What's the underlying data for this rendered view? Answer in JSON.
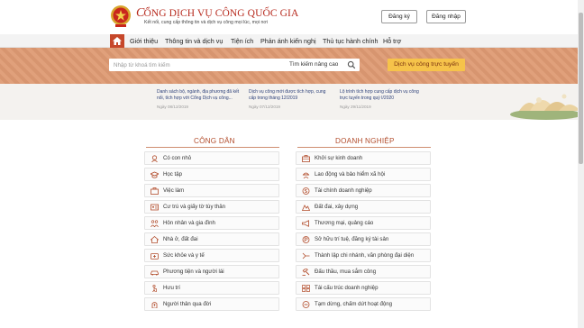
{
  "header": {
    "title_first_letter": "C",
    "title_rest": "ỔNG DỊCH VỤ CÔNG QUỐC GIA",
    "subtitle": "Kết nối, cung cấp thông tin và dịch vụ công mọi lúc, mọi nơi",
    "register_label": "Đăng ký",
    "login_label": "Đăng nhập"
  },
  "nav": {
    "items": [
      "Giới thiệu",
      "Thông tin và dịch vụ",
      "Tiện ích",
      "Phản ánh kiến nghị",
      "Thủ tục hành chính",
      "Hỗ trợ"
    ]
  },
  "search": {
    "placeholder": "Nhập từ khoá tìm kiếm",
    "advanced_label": "Tìm kiếm nâng cao",
    "public_service_label": "Dịch vụ công trực tuyến"
  },
  "news": [
    {
      "title": "Danh sách bộ, ngành, địa phương đã kết nối, tích hợp với Cổng Dịch vụ công...",
      "date": "Ngày 08/12/2019"
    },
    {
      "title": "Dịch vụ công mới được tích hợp, cung cấp trong tháng 12/2019",
      "date": "Ngày 07/12/2019"
    },
    {
      "title": "Lộ trình tích hợp cung cấp dịch vụ công trực tuyến trong quý I/2020",
      "date": "Ngày 29/11/2019"
    }
  ],
  "citizen": {
    "title": "CÔNG DÂN",
    "items": [
      {
        "label": "Có con nhỏ",
        "icon": "baby-icon"
      },
      {
        "label": "Học tập",
        "icon": "graduation-cap-icon"
      },
      {
        "label": "Việc làm",
        "icon": "briefcase-icon"
      },
      {
        "label": "Cư trú và giấy tờ tùy thân",
        "icon": "id-card-icon"
      },
      {
        "label": "Hôn nhân và gia đình",
        "icon": "family-icon"
      },
      {
        "label": "Nhà ở, đất đai",
        "icon": "house-icon"
      },
      {
        "label": "Sức khỏe và y tế",
        "icon": "medical-icon"
      },
      {
        "label": "Phương tiện và người lái",
        "icon": "car-icon"
      },
      {
        "label": "Hưu trí",
        "icon": "retirement-icon"
      },
      {
        "label": "Người thân qua đời",
        "icon": "memorial-icon"
      }
    ]
  },
  "business": {
    "title": "DOANH NGHIỆP",
    "items": [
      {
        "label": "Khởi sự kinh doanh",
        "icon": "startup-icon"
      },
      {
        "label": "Lao động và bảo hiểm xã hội",
        "icon": "worker-icon"
      },
      {
        "label": "Tài chính doanh nghiệp",
        "icon": "finance-icon"
      },
      {
        "label": "Đất đai, xây dựng",
        "icon": "construction-icon"
      },
      {
        "label": "Thương mại, quảng cáo",
        "icon": "megaphone-icon"
      },
      {
        "label": "Sở hữu trí tuệ, đăng ký tài sản",
        "icon": "intellectual-property-icon"
      },
      {
        "label": "Thành lập chi nhánh, văn phòng đại diện",
        "icon": "branch-office-icon"
      },
      {
        "label": "Đấu thầu, mua sắm công",
        "icon": "auction-icon"
      },
      {
        "label": "Tái cấu trúc doanh nghiệp",
        "icon": "restructure-icon"
      },
      {
        "label": "Tạm dừng, chấm dứt hoạt động",
        "icon": "stop-icon"
      }
    ]
  },
  "colors": {
    "brand_red": "#b72a1e",
    "nav_active": "#c6472a",
    "banner": "#de9a73",
    "cta": "#f6c34a",
    "section_title": "#b24d2c",
    "news_title": "#2a3e78"
  }
}
